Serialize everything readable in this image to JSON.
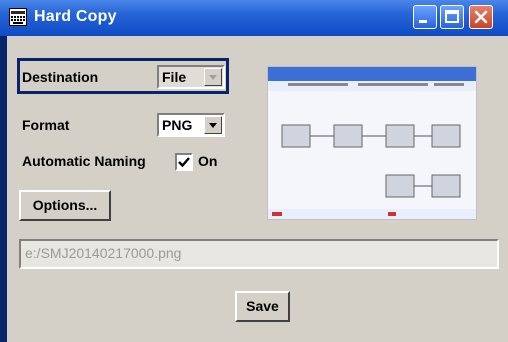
{
  "window": {
    "title": "Hard Copy",
    "controls": {
      "minimize": "minimize",
      "maximize": "maximize",
      "close": "close"
    }
  },
  "form": {
    "destination": {
      "label": "Destination",
      "value": "File",
      "enabled": false
    },
    "format": {
      "label": "Format",
      "value": "PNG"
    },
    "automatic_naming": {
      "label": "Automatic Naming",
      "checked": true,
      "state_label": "On"
    },
    "options_button": "Options...",
    "file_path": "e:/SMJ20140217000.png",
    "save_button": "Save"
  },
  "colors": {
    "titlebar": "#2563d8",
    "window_border": "#0a246a",
    "dialog_background": "#d4d0c8",
    "close_button": "#c9442a"
  }
}
